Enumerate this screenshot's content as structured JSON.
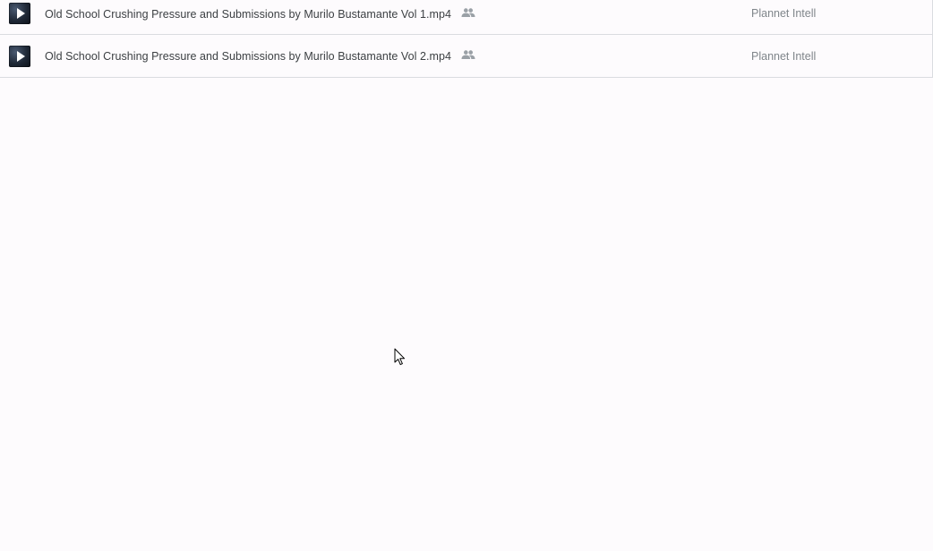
{
  "files": [
    {
      "name": "Old School Crushing Pressure and Submissions by Murilo Bustamante Vol 1.mp4",
      "icon": "video-thumbnail-icon",
      "shared": true,
      "owner": "Plannet Intell"
    },
    {
      "name": "Old School Crushing Pressure and Submissions by Murilo Bustamante Vol 2.mp4",
      "icon": "video-thumbnail-icon",
      "shared": true,
      "owner": "Plannet Intell"
    }
  ],
  "colors": {
    "background": "#fdfbfd",
    "divider": "#dadce0",
    "name_text": "#3c4043",
    "owner_text": "#80868b",
    "shared_icon": "#9aa0a6"
  },
  "icons": {
    "shared": "people-icon",
    "cursor": "mouse-pointer-icon"
  }
}
